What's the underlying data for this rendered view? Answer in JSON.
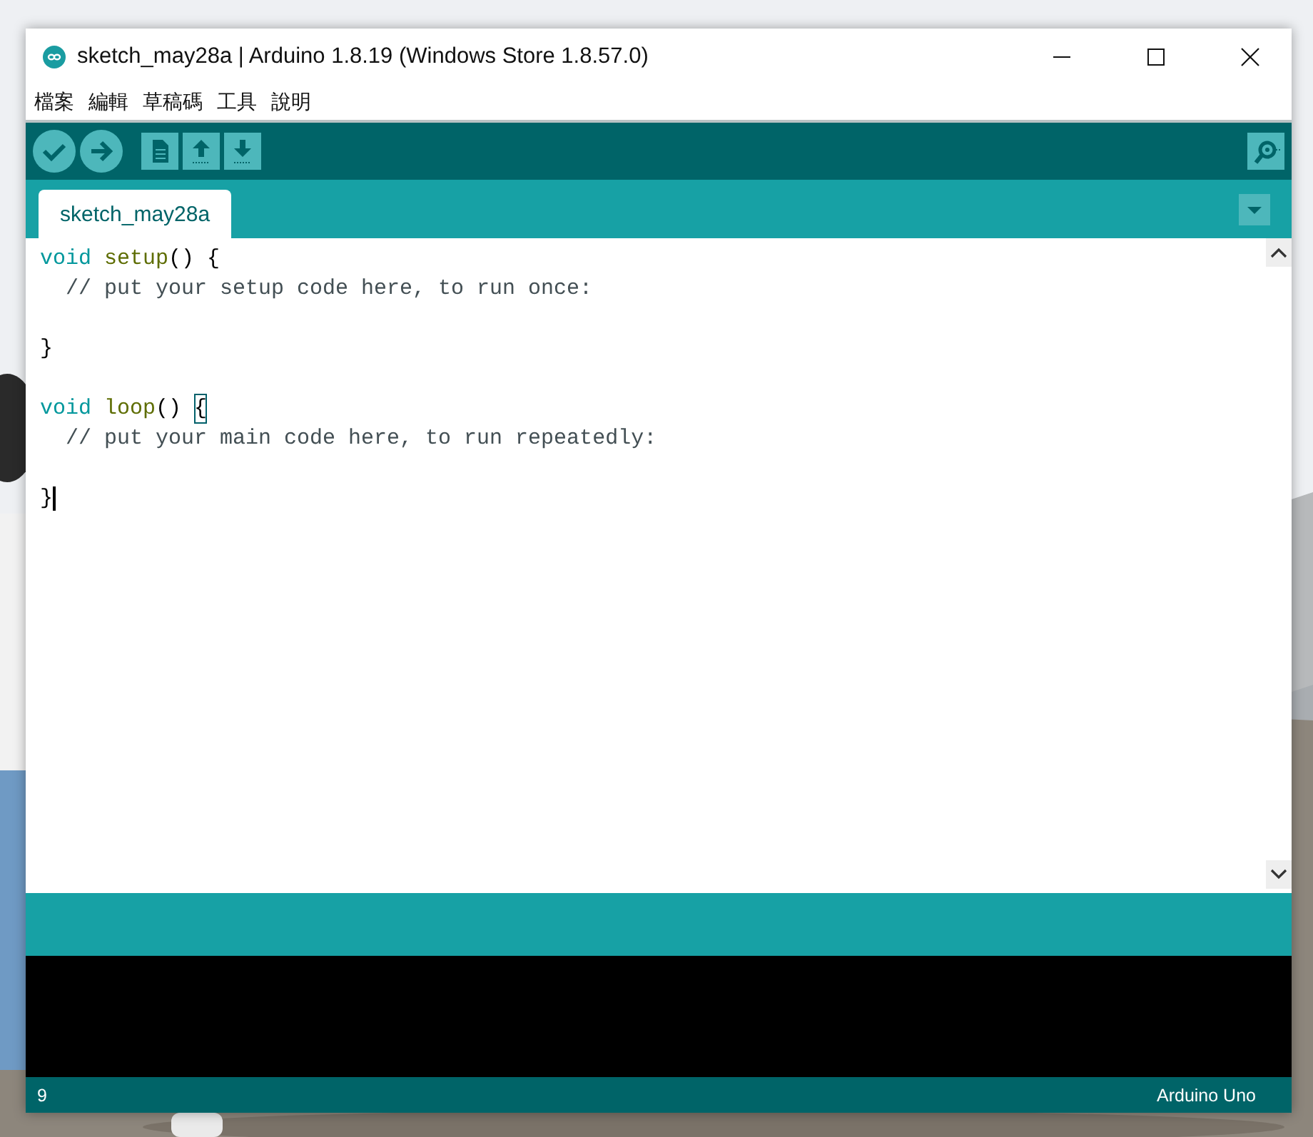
{
  "window": {
    "title": "sketch_may28a | Arduino 1.8.19 (Windows Store 1.8.57.0)"
  },
  "menu": [
    "檔案",
    "編輯",
    "草稿碼",
    "工具",
    "說明"
  ],
  "tabs": [
    {
      "label": "sketch_may28a",
      "selected": true
    }
  ],
  "editor": {
    "lines": [
      {
        "kind": "code",
        "cursor": false,
        "tokens": [
          {
            "text": "void",
            "kind": "keyword"
          },
          {
            "text": " setup",
            "kind": "function"
          },
          {
            "text": "() {",
            "kind": "plain"
          }
        ]
      },
      {
        "kind": "code",
        "cursor": false,
        "tokens": [
          {
            "text": "  // put your setup code here, to run once:",
            "kind": "comment"
          }
        ]
      },
      {
        "kind": "blank",
        "cursor": false
      },
      {
        "kind": "code",
        "cursor": false,
        "tokens": [
          {
            "text": "}",
            "kind": "plain"
          }
        ]
      },
      {
        "kind": "blank",
        "cursor": false
      },
      {
        "kind": "code",
        "cursor": false,
        "tokens": [
          {
            "text": "void",
            "kind": "keyword"
          },
          {
            "text": " loop",
            "kind": "function"
          },
          {
            "text": "() ",
            "kind": "plain"
          },
          {
            "text": "{",
            "kind": "bracket-match"
          }
        ]
      },
      {
        "kind": "code",
        "cursor": false,
        "tokens": [
          {
            "text": "  // put your main code here, to run repeatedly:",
            "kind": "comment"
          }
        ]
      },
      {
        "kind": "blank",
        "cursor": false
      },
      {
        "kind": "code",
        "cursor": true,
        "tokens": [
          {
            "text": "}",
            "kind": "plain"
          }
        ]
      }
    ]
  },
  "status_bar": {
    "line": "9",
    "board": "Arduino Uno"
  }
}
